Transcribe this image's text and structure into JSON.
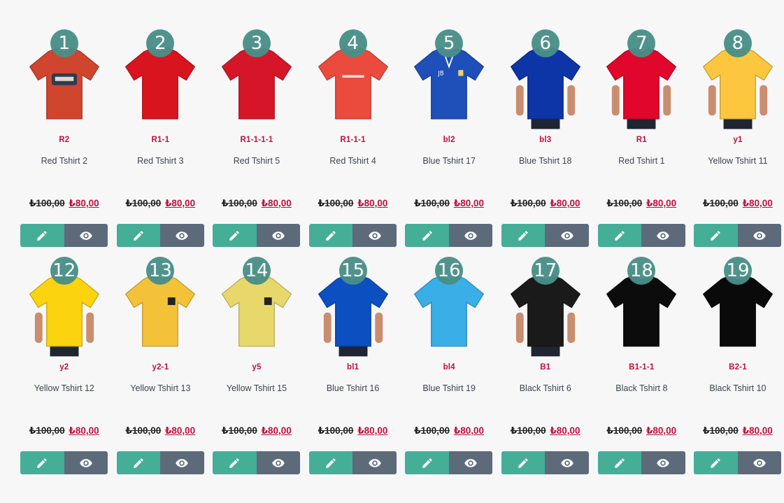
{
  "products": [
    {
      "index": "1",
      "ref": "R2",
      "name": "Red Tshirt 2",
      "old_price": "₺100,00",
      "new_price": "₺80,00",
      "color": "#d0452e",
      "person": false,
      "print": "logo"
    },
    {
      "index": "2",
      "ref": "R1-1",
      "name": "Red Tshirt 3",
      "old_price": "₺100,00",
      "new_price": "₺80,00",
      "color": "#d8141f",
      "person": false,
      "print": "none"
    },
    {
      "index": "3",
      "ref": "R1-1-1-1",
      "name": "Red Tshirt 5",
      "old_price": "₺100,00",
      "new_price": "₺80,00",
      "color": "#d51628",
      "person": false,
      "print": "none"
    },
    {
      "index": "4",
      "ref": "R1-1-1",
      "name": "Red Tshirt 4",
      "old_price": "₺100,00",
      "new_price": "₺80,00",
      "color": "#ea4b3c",
      "person": false,
      "print": "stripe"
    },
    {
      "index": "5",
      "ref": "bl2",
      "name": "Blue Tshirt 17",
      "old_price": "₺100,00",
      "new_price": "₺80,00",
      "color": "#1f4fb8",
      "person": false,
      "print": "polo"
    },
    {
      "index": "6",
      "ref": "bl3",
      "name": "Blue Tshirt 18",
      "old_price": "₺100,00",
      "new_price": "₺80,00",
      "color": "#0d35a8",
      "person": true,
      "print": "none"
    },
    {
      "index": "7",
      "ref": "R1",
      "name": "Red Tshirt 1",
      "old_price": "₺100,00",
      "new_price": "₺80,00",
      "color": "#e0062c",
      "person": true,
      "print": "none"
    },
    {
      "index": "8",
      "ref": "y1",
      "name": "Yellow Tshirt 11",
      "old_price": "₺100,00",
      "new_price": "₺80,00",
      "color": "#fcc73e",
      "person": true,
      "print": "none"
    },
    {
      "index": "12",
      "ref": "y2",
      "name": "Yellow Tshirt 12",
      "old_price": "₺100,00",
      "new_price": "₺80,00",
      "color": "#fbd40f",
      "person": true,
      "print": "none"
    },
    {
      "index": "13",
      "ref": "y2-1",
      "name": "Yellow Tshirt 13",
      "old_price": "₺100,00",
      "new_price": "₺80,00",
      "color": "#f3c239",
      "person": false,
      "print": "patch"
    },
    {
      "index": "14",
      "ref": "y5",
      "name": "Yellow Tshirt 15",
      "old_price": "₺100,00",
      "new_price": "₺80,00",
      "color": "#e8d86c",
      "person": false,
      "print": "patch"
    },
    {
      "index": "15",
      "ref": "bl1",
      "name": "Blue Tshirt 16",
      "old_price": "₺100,00",
      "new_price": "₺80,00",
      "color": "#0c4fc0",
      "person": true,
      "print": "none"
    },
    {
      "index": "16",
      "ref": "bl4",
      "name": "Blue Tshirt 19",
      "old_price": "₺100,00",
      "new_price": "₺80,00",
      "color": "#3aaee6",
      "person": false,
      "print": "none"
    },
    {
      "index": "17",
      "ref": "B1",
      "name": "Black Tshirt 6",
      "old_price": "₺100,00",
      "new_price": "₺80,00",
      "color": "#1a1a1a",
      "person": true,
      "print": "none"
    },
    {
      "index": "18",
      "ref": "B1-1-1",
      "name": "Black Tshirt 8",
      "old_price": "₺100,00",
      "new_price": "₺80,00",
      "color": "#0c0c0c",
      "person": false,
      "print": "none"
    },
    {
      "index": "19",
      "ref": "B2-1",
      "name": "Black Tshirt 10",
      "old_price": "₺100,00",
      "new_price": "₺80,00",
      "color": "#0a0a0a",
      "person": false,
      "print": "none"
    }
  ],
  "icons": {
    "edit": "pencil-icon",
    "view": "eye-icon"
  },
  "colors": {
    "accent_green": "#44ae97",
    "slate": "#5d6a7a",
    "badge": "#4a8f88",
    "ref_red": "#c0103a"
  }
}
